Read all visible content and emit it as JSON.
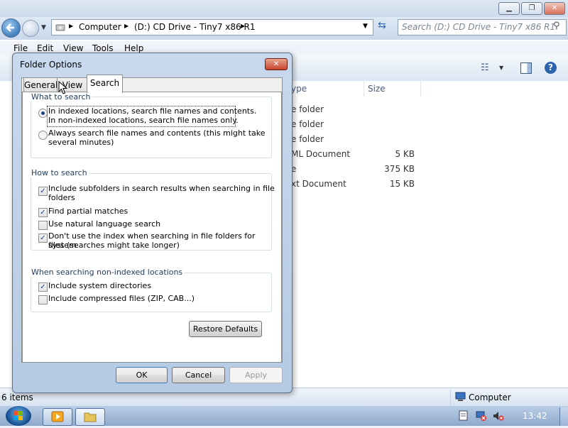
{
  "explorer": {
    "address": {
      "items": [
        "Computer",
        "(D:) CD Drive - Tiny7 x86 R1"
      ]
    },
    "search_placeholder": "Search (D:) CD Drive - Tiny7 x86 R1",
    "menu": [
      "File",
      "Edit",
      "View",
      "Tools",
      "Help"
    ],
    "columns": {
      "type": "ype",
      "size": "Size"
    },
    "files": [
      {
        "type": "e folder",
        "size": ""
      },
      {
        "type": "e folder",
        "size": ""
      },
      {
        "type": "e folder",
        "size": ""
      },
      {
        "type": "ML Document",
        "size": "5 KB"
      },
      {
        "type": "e",
        "size": "375 KB"
      },
      {
        "type": "xt Document",
        "size": "15 KB"
      }
    ],
    "status_left": "6 items",
    "status_right": "Computer"
  },
  "dialog": {
    "title": "Folder Options",
    "tabs": [
      "General",
      "View",
      "Search"
    ],
    "active_tab": "Search",
    "what_to_search": {
      "title": "What to search",
      "option1_line1": "In indexed locations, search file names and contents.",
      "option1_line2": "In non-indexed locations, search file names only.",
      "option2_line1": "Always search file names and contents (this might take",
      "option2_line2": "several minutes)",
      "selected": 0
    },
    "how_to_search": {
      "title": "How to search",
      "items": [
        {
          "line1": "Include subfolders in search results when searching in file",
          "line2": "folders",
          "checked": true
        },
        {
          "line1": "Find partial matches",
          "line2": "",
          "checked": true
        },
        {
          "line1": "Use natural language search",
          "line2": "",
          "checked": false
        },
        {
          "line1": "Don't use the index when searching in file folders for system",
          "line2": "files (searches might take longer)",
          "checked": true
        }
      ]
    },
    "non_indexed": {
      "title": "When searching non-indexed locations",
      "items": [
        {
          "label": "Include system directories",
          "checked": true
        },
        {
          "label": "Include compressed files (ZIP, CAB...)",
          "checked": false
        }
      ]
    },
    "restore_label": "Restore Defaults",
    "ok_label": "OK",
    "cancel_label": "Cancel",
    "apply_label": "Apply"
  },
  "taskbar": {
    "clock": "13:42"
  },
  "check_glyph": "✓"
}
